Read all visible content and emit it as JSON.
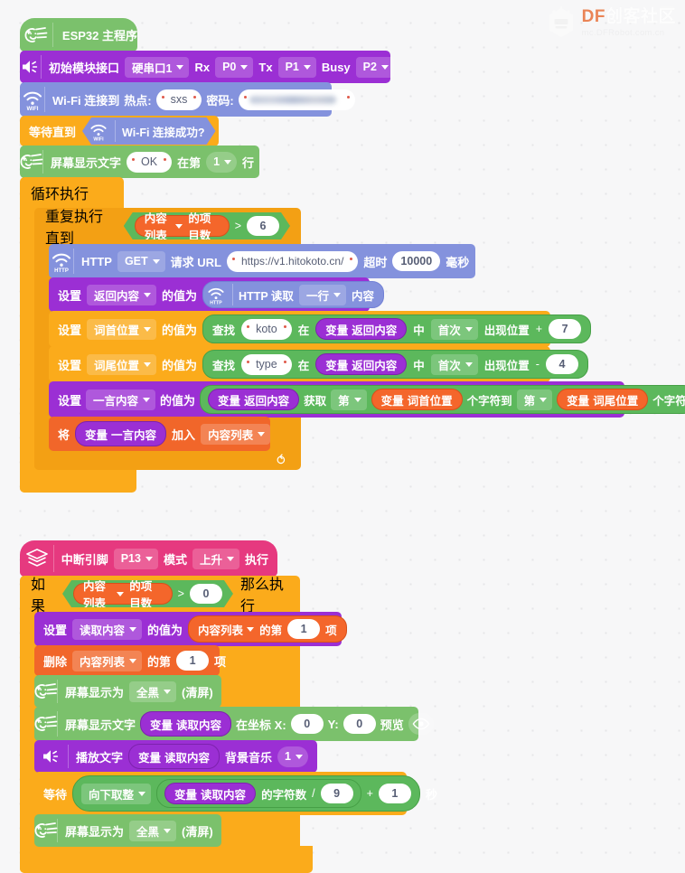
{
  "watermark": {
    "brand_df": "DF",
    "brand_cn": "创客社区",
    "site": "mc.DFRobot.com.cn"
  },
  "colors": {
    "canvas": "#f7f7f8",
    "event_green": "#7bc16c",
    "audio_purple": "#9b2fd4",
    "wifi_periwinkle": "#8492dd",
    "control_orange": "#fbab1b",
    "list_orange": "#f4662b",
    "operator_green": "#5cb85c",
    "interrupt_pink": "#e6397f"
  },
  "script_main": {
    "hat": {
      "icon": "esp32-display-icon",
      "label": "ESP32 主程序"
    },
    "blocks": [
      {
        "id": "init-module",
        "icon": "speaker-icon",
        "label": "初始模块接口",
        "port": "硬串口1",
        "rx_label": "Rx",
        "rx": "P0",
        "tx_label": "Tx",
        "tx": "P1",
        "busy_label": "Busy",
        "busy": "P2"
      },
      {
        "id": "wifi-connect",
        "icon": "wifi-icon",
        "label": "Wi-Fi 连接到",
        "ssid_label": "热点:",
        "ssid": "sxs",
        "password_label": "密码:",
        "password": ""
      },
      {
        "id": "wait-until-wifi",
        "label": "等待直到",
        "condition_icon": "wifi-icon",
        "condition": "Wi-Fi 连接成功?"
      },
      {
        "id": "screen-show-text-line",
        "icon": "esp32-display-icon",
        "prefix": "屏幕显示文字",
        "text": "OK",
        "mid": "在第",
        "line": "1",
        "suffix": "行"
      }
    ],
    "forever": {
      "id": "forever-loop",
      "label": "循环执行",
      "repeat_until": {
        "id": "repeat-until",
        "label": "重复执行直到",
        "list_name": "内容列表",
        "list_suffix": "的项目数",
        "operator": ">",
        "compare": "6"
      },
      "body": [
        {
          "id": "http-request",
          "icon": "wifi-http-icon",
          "prefix": "HTTP",
          "method": "GET",
          "url_label": "请求 URL",
          "url": "https://v1.hitokoto.cn/",
          "timeout_label": "超时",
          "timeout": "10000",
          "timeout_unit": "毫秒"
        },
        {
          "id": "set-return-content",
          "set": "设置",
          "var": "返回内容",
          "to": "的值为",
          "icon": "wifi-http-icon",
          "read_label": "HTTP 读取",
          "mode": "一行",
          "read_suffix": "内容"
        },
        {
          "id": "set-word-start",
          "set": "设置",
          "var": "词首位置",
          "to": "的值为",
          "find": "查找",
          "needle": "koto",
          "in": "在",
          "haystack_prefix": "变量",
          "haystack": "返回内容",
          "mid": "中",
          "occurrence": "首次",
          "pos_label": "出现位置",
          "op": "+",
          "operand": "7"
        },
        {
          "id": "set-word-end",
          "set": "设置",
          "var": "词尾位置",
          "to": "的值为",
          "find": "查找",
          "needle": "type",
          "in": "在",
          "haystack_prefix": "变量",
          "haystack": "返回内容",
          "mid": "中",
          "occurrence": "首次",
          "pos_label": "出现位置",
          "op": "-",
          "operand": "4"
        },
        {
          "id": "set-hitokoto-content",
          "set": "设置",
          "var": "一言内容",
          "to": "的值为",
          "src_prefix": "变量",
          "src": "返回内容",
          "get": "获取",
          "from_label": "第",
          "from_prefix": "变量",
          "from_var": "词首位置",
          "chars_to": "个字符到",
          "to_label": "第",
          "to_prefix": "变量",
          "to_var": "词尾位置",
          "chars": "个字符"
        },
        {
          "id": "add-to-list",
          "prefix": "将",
          "var_prefix": "变量",
          "var": "一言内容",
          "action": "加入",
          "list": "内容列表"
        }
      ]
    }
  },
  "script_interrupt": {
    "hat": {
      "icon": "layers-icon",
      "label": "中断引脚",
      "pin": "P13",
      "mode_label": "模式",
      "mode": "上升",
      "suffix": "执行"
    },
    "if_block": {
      "id": "if-list-count",
      "label": "如果",
      "list_name": "内容列表",
      "list_suffix": "的项目数",
      "operator": ">",
      "compare": "0",
      "then": "那么执行"
    },
    "body": [
      {
        "id": "set-read-content",
        "set": "设置",
        "var": "读取内容",
        "to": "的值为",
        "list": "内容列表",
        "item_prefix": "的第",
        "index": "1",
        "item_suffix": "项"
      },
      {
        "id": "delete-list-item",
        "prefix": "删除",
        "list": "内容列表",
        "item_prefix": "的第",
        "index": "1",
        "item_suffix": "项"
      },
      {
        "id": "screen-clear-1",
        "icon": "esp32-display-icon",
        "prefix": "屏幕显示为",
        "mode": "全黑",
        "suffix": "(清屏)"
      },
      {
        "id": "screen-show-var",
        "icon": "esp32-display-icon",
        "prefix": "屏幕显示文字",
        "var_prefix": "变量",
        "var": "读取内容",
        "coord_label": "在坐标 X:",
        "x": "0",
        "y_label": "Y:",
        "y": "0",
        "preview_label": "预览",
        "preview_icon": "eye-icon"
      },
      {
        "id": "play-text",
        "icon": "speaker-icon",
        "prefix": "播放文字",
        "var_prefix": "变量",
        "var": "读取内容",
        "bgm_label": "背景音乐",
        "bgm": "1"
      },
      {
        "id": "wait-seconds",
        "prefix": "等待",
        "round_mode": "向下取整",
        "var_prefix": "变量",
        "var": "读取内容",
        "length_label": "的字符数",
        "div_op": "/",
        "divisor": "9",
        "add_op": "+",
        "addend": "1",
        "unit": "秒"
      },
      {
        "id": "screen-clear-2",
        "icon": "esp32-display-icon",
        "prefix": "屏幕显示为",
        "mode": "全黑",
        "suffix": "(清屏)"
      }
    ]
  }
}
